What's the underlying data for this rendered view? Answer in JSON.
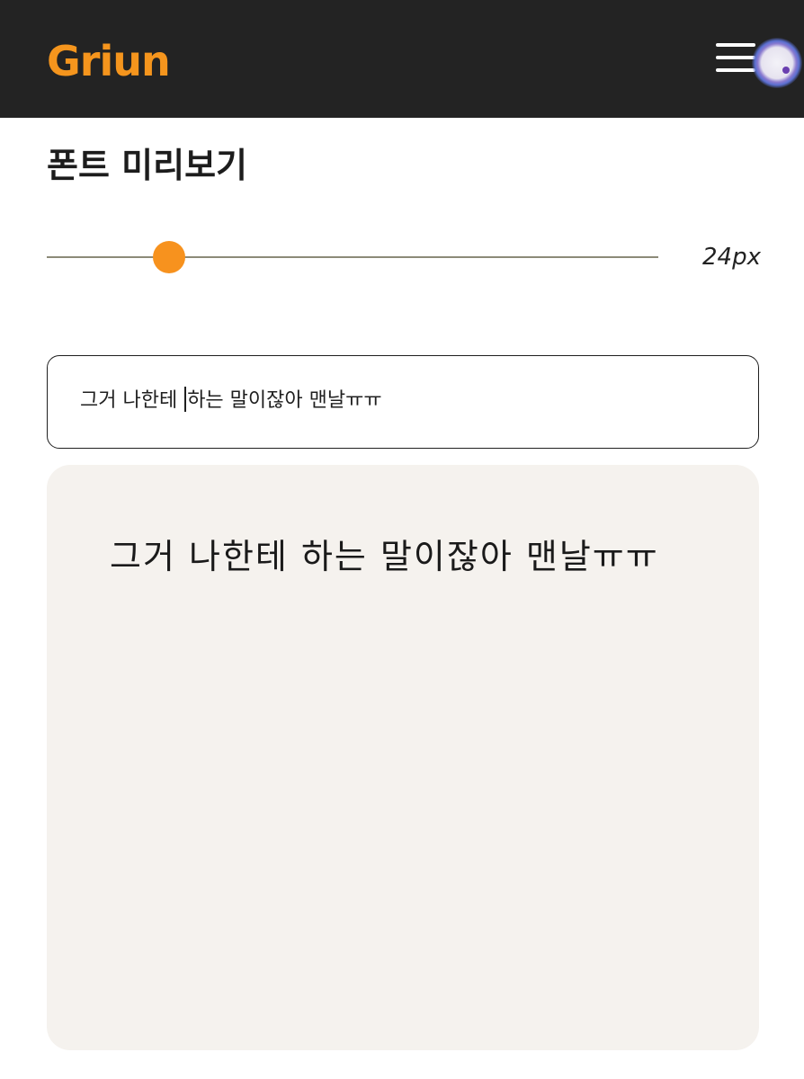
{
  "app": {
    "logo_text": "Griun",
    "brand_color": "#f5951d",
    "header_bg": "#232323"
  },
  "header": {
    "menu_icon": "hamburger-menu-icon",
    "assistant_icon": "assistant-orb-icon"
  },
  "page": {
    "title": "폰트 미리보기"
  },
  "font_size_slider": {
    "value_label": "24px",
    "value_fraction": 0.2,
    "accent_color": "#f7921e"
  },
  "text_input": {
    "value_before_caret": "그거 나한테 ",
    "value_after_caret": "하는 말이잖아 맨날ㅠㅠ"
  },
  "preview": {
    "text": "그거 나한테 하는 말이잖아 맨날ㅠㅠ",
    "background_color": "#f5f2ee"
  }
}
